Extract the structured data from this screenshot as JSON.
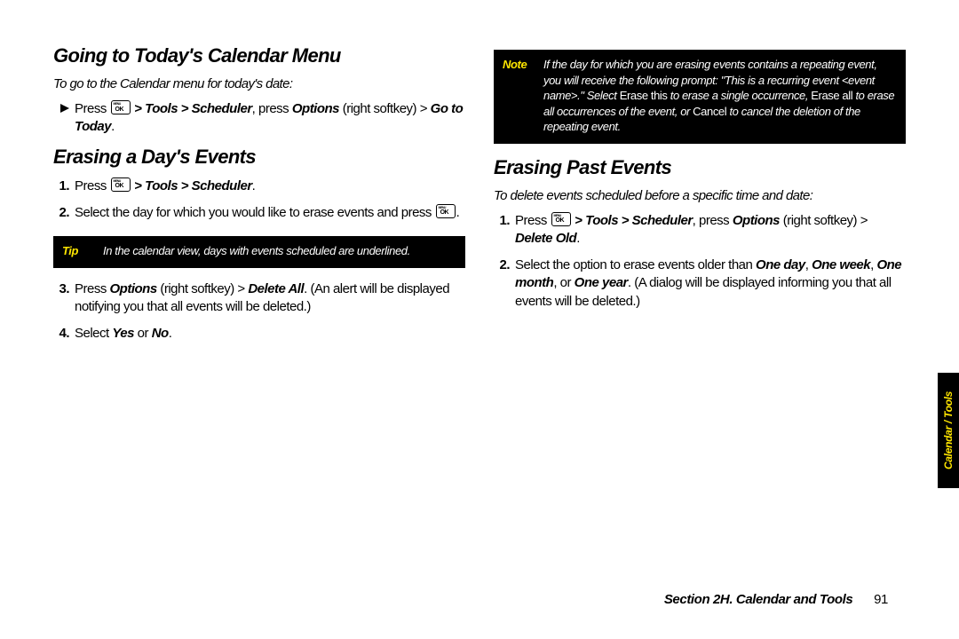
{
  "left": {
    "h1": "Going to Today's Calendar Menu",
    "intro1": "To go to the Calendar menu for today's date:",
    "bullet1_a": "Press ",
    "bullet1_b": " > Tools > Scheduler",
    "bullet1_c": ", press ",
    "bullet1_d": "Options",
    "bullet1_e": " (right softkey) > ",
    "bullet1_f": "Go to Today",
    "bullet1_g": ".",
    "h2": "Erasing a Day's Events",
    "s1_a": "Press ",
    "s1_b": " > Tools > Scheduler",
    "s1_c": ".",
    "s2_a": "Select the day for which you would like to erase events and press ",
    "s2_b": ".",
    "tip_tag": "Tip",
    "tip_body": "In the calendar view, days with events scheduled are underlined.",
    "s3_a": "Press ",
    "s3_b": "Options",
    "s3_c": " (right softkey) > ",
    "s3_d": "Delete All",
    "s3_e": ". (An alert will be displayed notifying you that all events will be deleted.)",
    "s4_a": "Select ",
    "s4_b": "Yes",
    "s4_c": " or ",
    "s4_d": "No",
    "s4_e": "."
  },
  "right": {
    "note_tag": "Note",
    "note_a": "If the day for which you are erasing events contains a repeating event, you will receive the following prompt: \"This is a recurring event <event name>.\" Select ",
    "note_b": "Erase this",
    "note_c": " to erase a single occurrence, ",
    "note_d": "Erase all",
    "note_e": " to erase all occurrences of the event, or ",
    "note_f": "Cancel",
    "note_g": " to cancel the deletion of the repeating event.",
    "h1": "Erasing Past Events",
    "intro1": "To delete events scheduled before a specific time and date:",
    "s1_a": "Press ",
    "s1_b": " > Tools > Scheduler",
    "s1_c": ", press ",
    "s1_d": "Options",
    "s1_e": " (right softkey) > ",
    "s1_f": "Delete Old",
    "s1_g": ".",
    "s2_a": "Select the option to erase events older than ",
    "s2_b": "One day",
    "s2_c": ", ",
    "s2_d": "One week",
    "s2_e": ", ",
    "s2_f": "One month",
    "s2_g": ", or ",
    "s2_h": "One year",
    "s2_i": ". (A dialog will be displayed informing you that all events will be deleted.)"
  },
  "footer": {
    "section": "Section 2H. Calendar and Tools",
    "page": "91"
  },
  "tab": "Calendar / Tools"
}
